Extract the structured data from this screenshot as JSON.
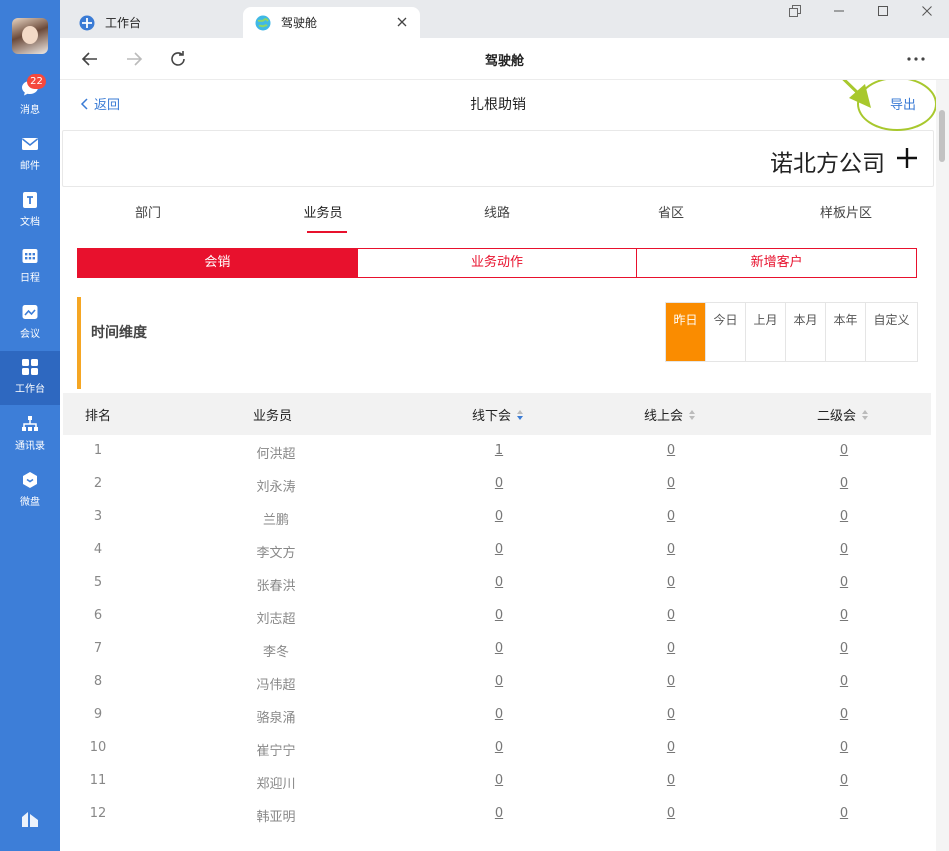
{
  "sidebar": {
    "badge": "22",
    "items": [
      {
        "label": "消息",
        "icon": "chat-bubble-icon"
      },
      {
        "label": "邮件",
        "icon": "mail-icon"
      },
      {
        "label": "文档",
        "icon": "document-icon"
      },
      {
        "label": "日程",
        "icon": "calendar-icon"
      },
      {
        "label": "会议",
        "icon": "meeting-icon"
      },
      {
        "label": "工作台",
        "icon": "grid-icon"
      },
      {
        "label": "通讯录",
        "icon": "org-chart-icon"
      },
      {
        "label": "微盘",
        "icon": "cloud-drive-icon"
      }
    ],
    "active_item": "工作台"
  },
  "tabs": [
    {
      "label": "工作台",
      "icon": "workbench-icon"
    },
    {
      "label": "驾驶舱",
      "icon": "globe-icon"
    }
  ],
  "toolbar": {
    "title": "驾驶舱"
  },
  "page": {
    "back_label": "返回",
    "title": "扎根助销",
    "export_label": "导出",
    "company": "诺北方公司"
  },
  "dimension_tabs": [
    "部门",
    "业务员",
    "线路",
    "省区",
    "样板片区"
  ],
  "active_dimension": "业务员",
  "segments": [
    "会销",
    "业务动作",
    "新增客户"
  ],
  "active_segment": "会销",
  "time": {
    "label": "时间维度",
    "options": [
      "昨日",
      "今日",
      "上月",
      "本月",
      "本年",
      "自定义"
    ],
    "active": "昨日"
  },
  "table": {
    "headers": [
      "排名",
      "业务员",
      "线下会",
      "线上会",
      "二级会"
    ],
    "rows": [
      [
        "1",
        "何洪超",
        "1",
        "0",
        "0"
      ],
      [
        "2",
        "刘永涛",
        "0",
        "0",
        "0"
      ],
      [
        "3",
        "兰鹏",
        "0",
        "0",
        "0"
      ],
      [
        "4",
        "李文方",
        "0",
        "0",
        "0"
      ],
      [
        "5",
        "张春洪",
        "0",
        "0",
        "0"
      ],
      [
        "6",
        "刘志超",
        "0",
        "0",
        "0"
      ],
      [
        "7",
        "李冬",
        "0",
        "0",
        "0"
      ],
      [
        "8",
        "冯伟超",
        "0",
        "0",
        "0"
      ],
      [
        "9",
        "骆泉涌",
        "0",
        "0",
        "0"
      ],
      [
        "10",
        "崔宁宁",
        "0",
        "0",
        "0"
      ],
      [
        "11",
        "郑迎川",
        "0",
        "0",
        "0"
      ],
      [
        "12",
        "韩亚明",
        "0",
        "0",
        "0"
      ]
    ]
  },
  "colors": {
    "sidebar": "#3d7ed8",
    "accent_red": "#e8112d",
    "accent_orange": "#fa8c00",
    "link_blue": "#3a7bd5",
    "annotation_green": "#a8c82d"
  }
}
